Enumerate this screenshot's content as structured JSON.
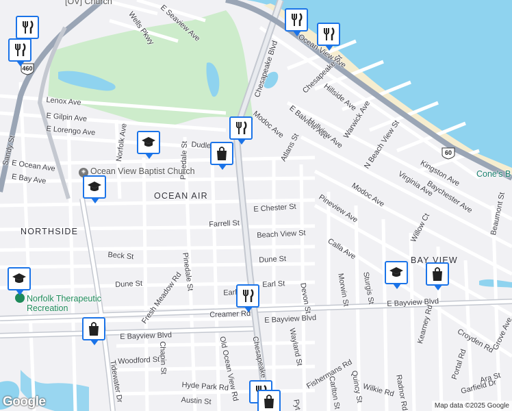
{
  "map": {
    "colors": {
      "water": "#8fd3ef",
      "park": "#cdeccb",
      "beach": "#f6edcf",
      "highway": "#9aa5b5",
      "arterial": "#c4c8d0",
      "street": "#ffffff",
      "marker_border": "#1a73e8"
    },
    "street_labels": [
      {
        "text": "Wells Pkwy"
      },
      {
        "text": "E Seaview Ave"
      },
      {
        "text": "Chesapeake Blvd"
      },
      {
        "text": "Ocean View Ave"
      },
      {
        "text": "Chesapeake St"
      },
      {
        "text": "Hillside Ave"
      },
      {
        "text": "Lenox Ave"
      },
      {
        "text": "E Gilpin Ave"
      },
      {
        "text": "E Lorengo Ave"
      },
      {
        "text": "Norfolk Ave"
      },
      {
        "text": "Dudley Ave"
      },
      {
        "text": "Modoc Ave"
      },
      {
        "text": "E Balview Ave"
      },
      {
        "text": "Warwick Ave"
      },
      {
        "text": "Atlans St"
      },
      {
        "text": "Hullview Ave"
      },
      {
        "text": "N Beach View St"
      },
      {
        "text": "E Ocean Ave"
      },
      {
        "text": "E Bay Ave"
      },
      {
        "text": "Pinedale St"
      },
      {
        "text": "Kingston Ave"
      },
      {
        "text": "Baychester Ave"
      },
      {
        "text": "Virginia Ave"
      },
      {
        "text": "Modoc Ave"
      },
      {
        "text": "E Chester St"
      },
      {
        "text": "Pineview Ave"
      },
      {
        "text": "Willow Ct"
      },
      {
        "text": "Beaumont St"
      },
      {
        "text": "Farrell St"
      },
      {
        "text": "Beach View St"
      },
      {
        "text": "Calla Ave"
      },
      {
        "text": "Beck St"
      },
      {
        "text": "Pinedale St"
      },
      {
        "text": "Dune St"
      },
      {
        "text": "Dune St"
      },
      {
        "text": "Fresh Meadow Rd"
      },
      {
        "text": "Earl St"
      },
      {
        "text": "Earl St"
      },
      {
        "text": "Devon St"
      },
      {
        "text": "Morwin St"
      },
      {
        "text": "Sturgis St"
      },
      {
        "text": "E Bayview Blvd"
      },
      {
        "text": "Creamer Rd"
      },
      {
        "text": "E Bayview Blvd"
      },
      {
        "text": "E Bayview Blvd"
      },
      {
        "text": "Kearney Rd"
      },
      {
        "text": "Croyden Rd"
      },
      {
        "text": "Grove Ave"
      },
      {
        "text": "Old Ocean View Rd"
      },
      {
        "text": "Chesapeake St"
      },
      {
        "text": "Wayland St"
      },
      {
        "text": "Woodford St"
      },
      {
        "text": "Chapin St"
      },
      {
        "text": "Portal Rd"
      },
      {
        "text": "Ara St"
      },
      {
        "text": "Garfield Dr"
      },
      {
        "text": "Tidewater Dr"
      },
      {
        "text": "Hyde Park Rd"
      },
      {
        "text": "Fishermans Rd"
      },
      {
        "text": "Wilkie Rd"
      },
      {
        "text": "Quincy St"
      },
      {
        "text": "Radnor Rd"
      },
      {
        "text": "Carlton St"
      },
      {
        "text": "Austin St"
      },
      {
        "text": "Pyt"
      },
      {
        "text": "Sandy St"
      }
    ],
    "area_labels": [
      "OCEAN AIR",
      "NORTHSIDE",
      "BAY VIEW"
    ],
    "places": {
      "church": "Ocean View Baptist Church",
      "church_top": "[OV] Church",
      "therapeutic_line1": "Norfolk Therapeutic",
      "therapeutic_line2": "Recreation",
      "cones": "Cone's B"
    },
    "shields": {
      "us460": "460",
      "us60": "60"
    },
    "markers": [
      {
        "type": "restaurant",
        "icon": "fork-knife-icon"
      },
      {
        "type": "restaurant",
        "icon": "fork-knife-icon"
      },
      {
        "type": "restaurant",
        "icon": "fork-knife-icon"
      },
      {
        "type": "restaurant",
        "icon": "fork-knife-icon"
      },
      {
        "type": "restaurant",
        "icon": "fork-knife-icon"
      },
      {
        "type": "restaurant",
        "icon": "fork-knife-icon"
      },
      {
        "type": "restaurant",
        "icon": "fork-knife-icon"
      },
      {
        "type": "school",
        "icon": "graduation-cap-icon"
      },
      {
        "type": "school",
        "icon": "graduation-cap-icon"
      },
      {
        "type": "school",
        "icon": "graduation-cap-icon"
      },
      {
        "type": "school",
        "icon": "graduation-cap-icon"
      },
      {
        "type": "shopping",
        "icon": "shopping-bag-icon"
      },
      {
        "type": "shopping",
        "icon": "shopping-bag-icon"
      },
      {
        "type": "shopping",
        "icon": "shopping-bag-icon"
      },
      {
        "type": "shopping",
        "icon": "shopping-bag-icon"
      }
    ],
    "google_logo": "Google",
    "attribution": "Map data ©2025 Google"
  }
}
